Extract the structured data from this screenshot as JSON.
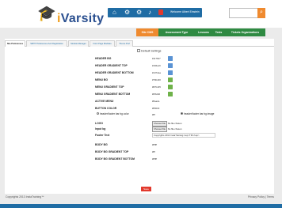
{
  "header": {
    "logo_text_prefix": "i",
    "logo_text_rest": "Varsity",
    "nav_icons": [
      "home-icon",
      "settings-icon",
      "gear-icon",
      "bell-icon"
    ],
    "welcome": "Welcome Albert Einstein",
    "search_placeholder": ""
  },
  "menu": {
    "items": [
      "Site CMS",
      "Assessment Type",
      "Lessons",
      "Tests",
      "Tickets Organizations"
    ]
  },
  "tabs": [
    "Site Preferences",
    "SMTP Preferences And Registration",
    "Module Manager",
    "Front Page Modules",
    "Theme Pref"
  ],
  "section_title": "Default Settings",
  "rows": [
    {
      "label": "HEADER BG",
      "value": "#1176d7"
    },
    {
      "label": "HEADER GRADIENT TOP",
      "value": "#166ac9"
    },
    {
      "label": "HEADER GRADIENT BOTTOM",
      "value": "#1372aa"
    },
    {
      "label": "MENU BG",
      "value": "#79bd30"
    },
    {
      "label": "MENU GRADIENT TOP",
      "value": "#87bd35"
    },
    {
      "label": "MENU GRADIENT BOTTOM",
      "value": "#6fb240"
    },
    {
      "label": "ACTIVE MENU",
      "value": "#ffaa2a"
    },
    {
      "label": "BUTTON COLOR",
      "value": "#ff9003"
    }
  ],
  "radio": {
    "left_label": "header/footer bar bg color",
    "left_value": "#fff",
    "right_label": "header/footer bar bg image"
  },
  "uploads": {
    "logo_label": "LOGO",
    "logo_button": "Choose File",
    "logo_status": "No file chosen",
    "inputbg_label": "Input bg",
    "inputbg_button": "Choose File",
    "inputbg_status": "No file chosen"
  },
  "footer_text": {
    "label": "Footer Text",
    "value": "Copyrights 2013 InstaTraining<sup>TM</sup>"
  },
  "body_rows": [
    {
      "label": "BODY BG",
      "value": "#ffffff"
    },
    {
      "label": "BODY BG GRADIENT TOP",
      "value": "#fff"
    },
    {
      "label": "BODY BG GRADIENT BOTTOM",
      "value": "#ffffff"
    }
  ],
  "save_label": "Save",
  "footer": {
    "copyright": "Copyrights 2013 InstaTraining™",
    "links": "Privacy Policy | Terms"
  }
}
